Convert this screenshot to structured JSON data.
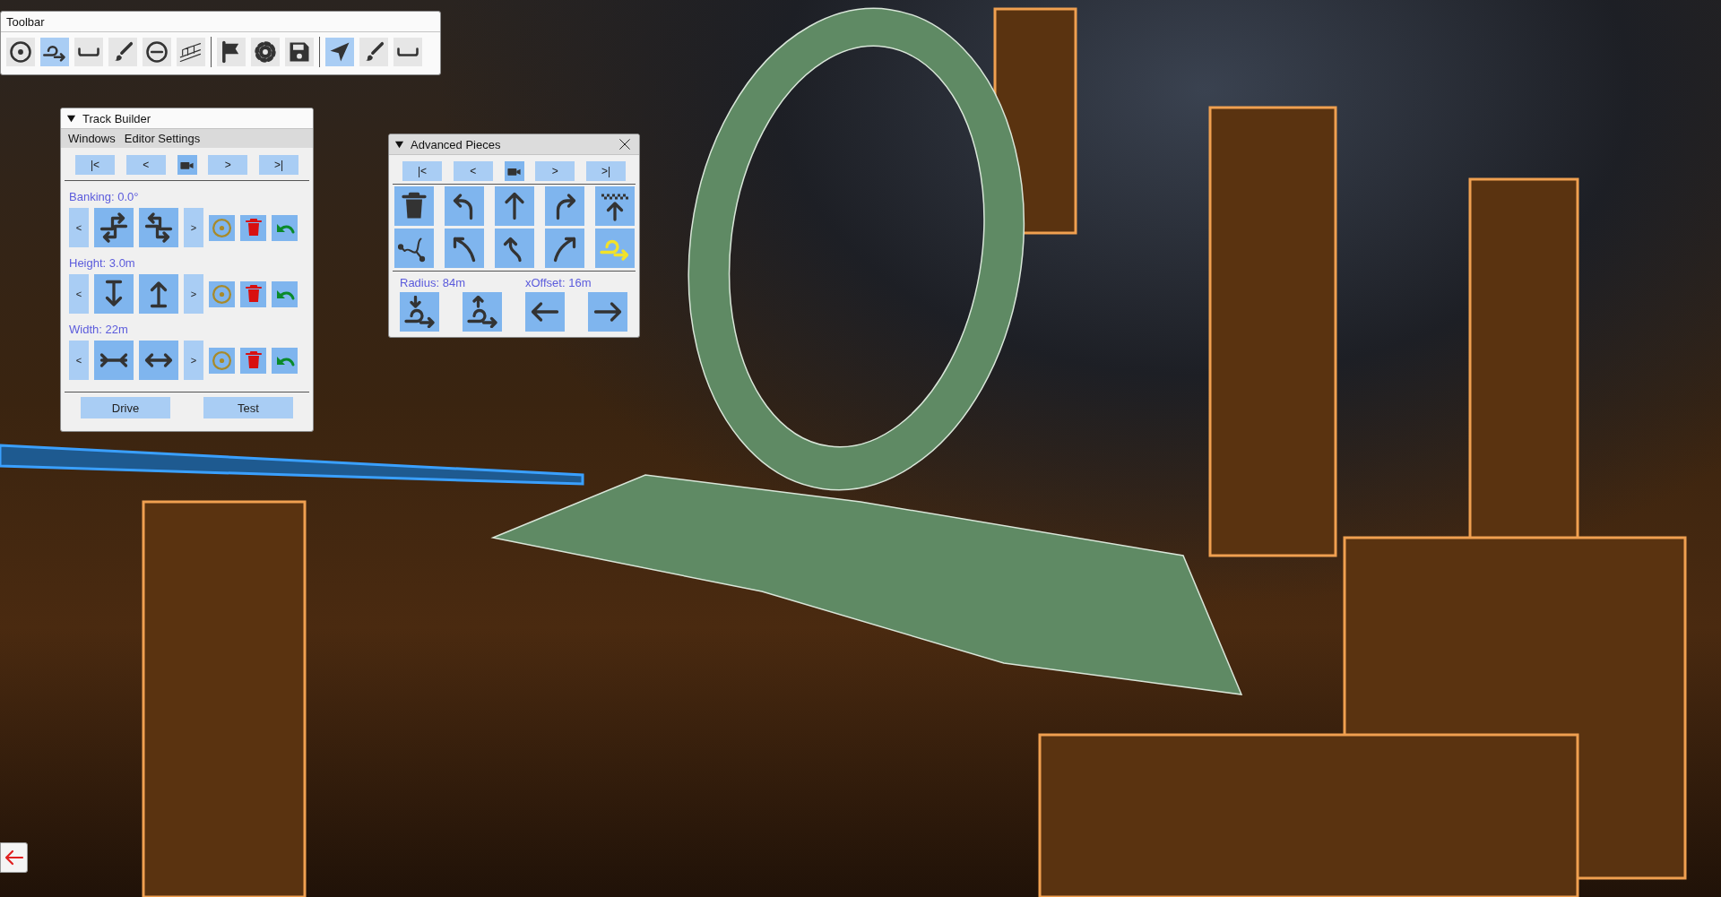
{
  "toolbar": {
    "title": "Toolbar",
    "groups": [
      {
        "tools": [
          {
            "kind": "target",
            "selected": false
          },
          {
            "kind": "loop",
            "selected": true
          },
          {
            "kind": "width",
            "selected": false
          },
          {
            "kind": "brush",
            "selected": false
          },
          {
            "kind": "minus",
            "selected": false
          },
          {
            "kind": "bridge",
            "selected": false
          }
        ]
      },
      {
        "tools": [
          {
            "kind": "flag",
            "selected": false
          },
          {
            "kind": "gear",
            "selected": false
          },
          {
            "kind": "save",
            "selected": false
          }
        ]
      },
      {
        "tools": [
          {
            "kind": "navigate",
            "selected": true
          },
          {
            "kind": "brush",
            "selected": false
          },
          {
            "kind": "width",
            "selected": false
          }
        ]
      }
    ]
  },
  "track_builder": {
    "title": "Track Builder",
    "menu": [
      "Windows",
      "Editor Settings"
    ],
    "nav": [
      {
        "kind": "text",
        "label": "|<"
      },
      {
        "kind": "text",
        "label": "<"
      },
      {
        "kind": "camera"
      },
      {
        "kind": "text",
        "label": ">"
      },
      {
        "kind": "text",
        "label": ">|"
      }
    ],
    "sections": [
      {
        "kind": "banking",
        "label": "Banking: 0.0°",
        "prev": "<",
        "next": ">"
      },
      {
        "kind": "height",
        "label": "Height: 3.0m",
        "prev": "<",
        "next": ">"
      },
      {
        "kind": "width",
        "label": "Width: 22m",
        "prev": "<",
        "next": ">"
      }
    ],
    "buttons": [
      "Drive",
      "Test"
    ]
  },
  "advanced_pieces": {
    "title": "Advanced Pieces",
    "nav": [
      {
        "kind": "text",
        "label": "|<"
      },
      {
        "kind": "text",
        "label": "<"
      },
      {
        "kind": "camera"
      },
      {
        "kind": "text",
        "label": ">"
      },
      {
        "kind": "text",
        "label": ">|"
      }
    ],
    "pieces": [
      {
        "kind": "trash",
        "selected": false
      },
      {
        "kind": "turn-left",
        "selected": false
      },
      {
        "kind": "straight",
        "selected": false
      },
      {
        "kind": "turn-right",
        "selected": false
      },
      {
        "kind": "finish",
        "selected": false
      },
      {
        "kind": "spline",
        "selected": false
      },
      {
        "kind": "sharp-left",
        "selected": false
      },
      {
        "kind": "s-curve",
        "selected": false
      },
      {
        "kind": "sharp-right",
        "selected": false
      },
      {
        "kind": "loop",
        "selected": true
      }
    ],
    "radius_label": "Radius: 84m",
    "offset_label": "xOffset: 16m",
    "adjust_buttons": [
      {
        "kind": "radius-down"
      },
      {
        "kind": "radius-up"
      },
      {
        "kind": "arrow-left"
      },
      {
        "kind": "arrow-right"
      }
    ]
  }
}
